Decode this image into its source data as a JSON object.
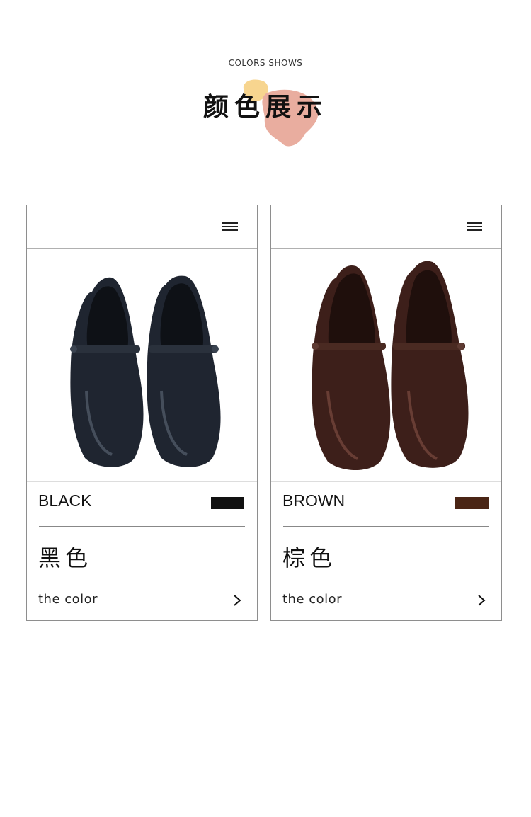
{
  "header": {
    "subtitle": "COLORS SHOWS",
    "title": "颜色展示"
  },
  "colors": {
    "blob_yellow": "#f7d58f",
    "blob_pink": "#e9ad9f"
  },
  "cards": [
    {
      "color_name_en": "BLACK",
      "color_name_cn": "黑色",
      "swatch_color": "#111111",
      "link_label": "the color",
      "shoe_color": "#1f2530",
      "shoe_highlight": "#56606e"
    },
    {
      "color_name_en": "BROWN",
      "color_name_cn": "棕色",
      "swatch_color": "#4a2515",
      "link_label": "the color",
      "shoe_color": "#3d1f1a",
      "shoe_highlight": "#7a4a40"
    }
  ],
  "icons": {
    "menu": "menu-icon",
    "arrow": "chevron-right-icon"
  }
}
